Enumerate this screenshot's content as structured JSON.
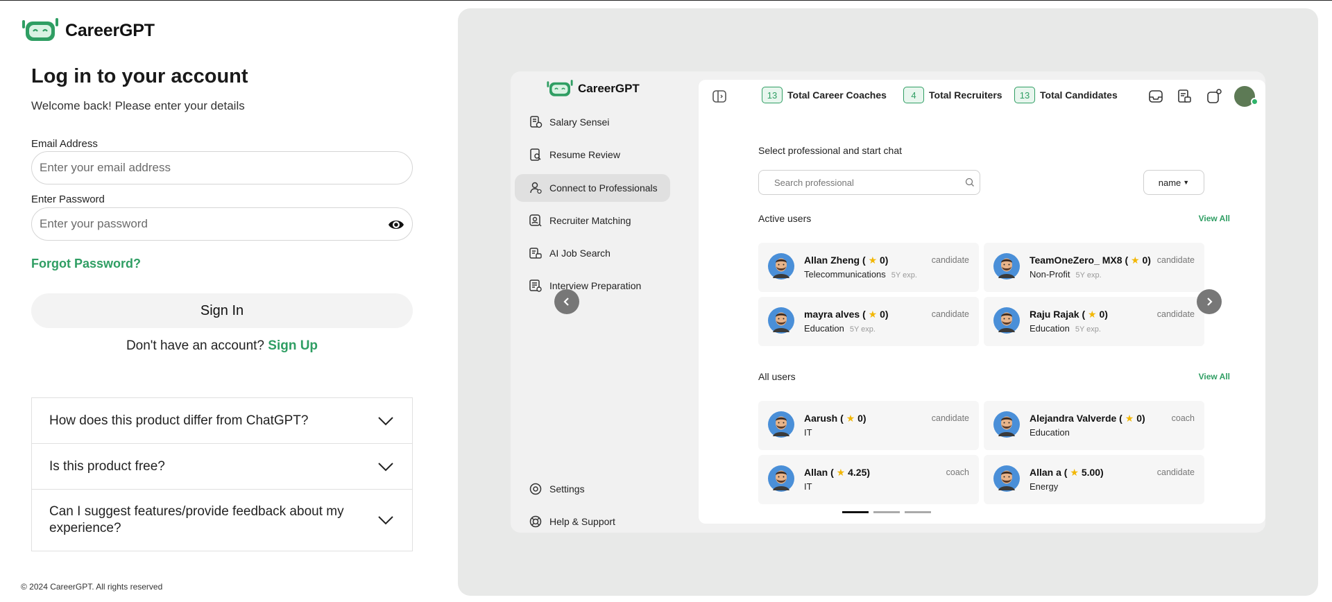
{
  "brand": {
    "name": "CareerGPT",
    "accent": "#2f9e63"
  },
  "login": {
    "title": "Log in to your account",
    "subtitle": "Welcome back! Please enter your details",
    "email_label": "Email Address",
    "email_placeholder": "Enter your email address",
    "password_label": "Enter Password",
    "password_placeholder": "Enter your password",
    "forgot": "Forgot Password?",
    "signin": "Sign In",
    "no_account": "Don't have an account?",
    "signup": "Sign Up"
  },
  "faq": [
    {
      "question": "How does this product differ from ChatGPT?"
    },
    {
      "question": "Is this product free?"
    },
    {
      "question": "Can I suggest features/provide feedback about my experience?"
    }
  ],
  "footer": "© 2024 CareerGPT. All rights reserved",
  "app": {
    "brand": "CareerGPT",
    "nav": [
      {
        "label": "Salary Sensei",
        "icon": "salary-icon"
      },
      {
        "label": "Resume Review",
        "icon": "resume-icon"
      },
      {
        "label": "Connect to Professionals",
        "icon": "professionals-icon",
        "active": true
      },
      {
        "label": "Recruiter Matching",
        "icon": "recruiter-icon"
      },
      {
        "label": "AI Job Search",
        "icon": "job-search-icon"
      },
      {
        "label": "Interview Preparation",
        "icon": "interview-icon"
      }
    ],
    "nav_bottom": [
      {
        "label": "Settings",
        "icon": "settings-icon"
      },
      {
        "label": "Help & Support",
        "icon": "help-icon"
      }
    ],
    "stats": [
      {
        "count": "13",
        "label": "Total Career Coaches"
      },
      {
        "count": "4",
        "label": "Total Recruiters"
      },
      {
        "count": "13",
        "label": "Total Candidates"
      }
    ],
    "select_title": "Select professional and start chat",
    "search_placeholder": "Search professional",
    "sort_label": "name",
    "active_title": "Active users",
    "all_title": "All users",
    "view_all": "View All",
    "active_users": [
      {
        "name": "Allan Zheng (",
        "rating": "0)",
        "sub": "Telecommunications",
        "exp": "5Y exp.",
        "role": "candidate"
      },
      {
        "name": "TeamOneZero_ MX8 (",
        "rating": "0)",
        "sub": "Non-Profit",
        "exp": "5Y exp.",
        "role": "candidate"
      },
      {
        "name": "mayra alves (",
        "rating": "0)",
        "sub": "Education",
        "exp": "5Y exp.",
        "role": "candidate"
      },
      {
        "name": "Raju Rajak (",
        "rating": "0)",
        "sub": "Education",
        "exp": "5Y exp.",
        "role": "candidate"
      }
    ],
    "all_users": [
      {
        "name": "Aarush (",
        "rating": "0)",
        "sub": "IT",
        "exp": "",
        "role": "candidate"
      },
      {
        "name": "Alejandra Valverde (",
        "rating": "0)",
        "sub": "Education",
        "exp": "",
        "role": "coach"
      },
      {
        "name": "Allan (",
        "rating": "4.25)",
        "sub": "IT",
        "exp": "",
        "role": "coach"
      },
      {
        "name": "Allan a (",
        "rating": "5.00)",
        "sub": "Energy",
        "exp": "",
        "role": "candidate"
      }
    ]
  }
}
